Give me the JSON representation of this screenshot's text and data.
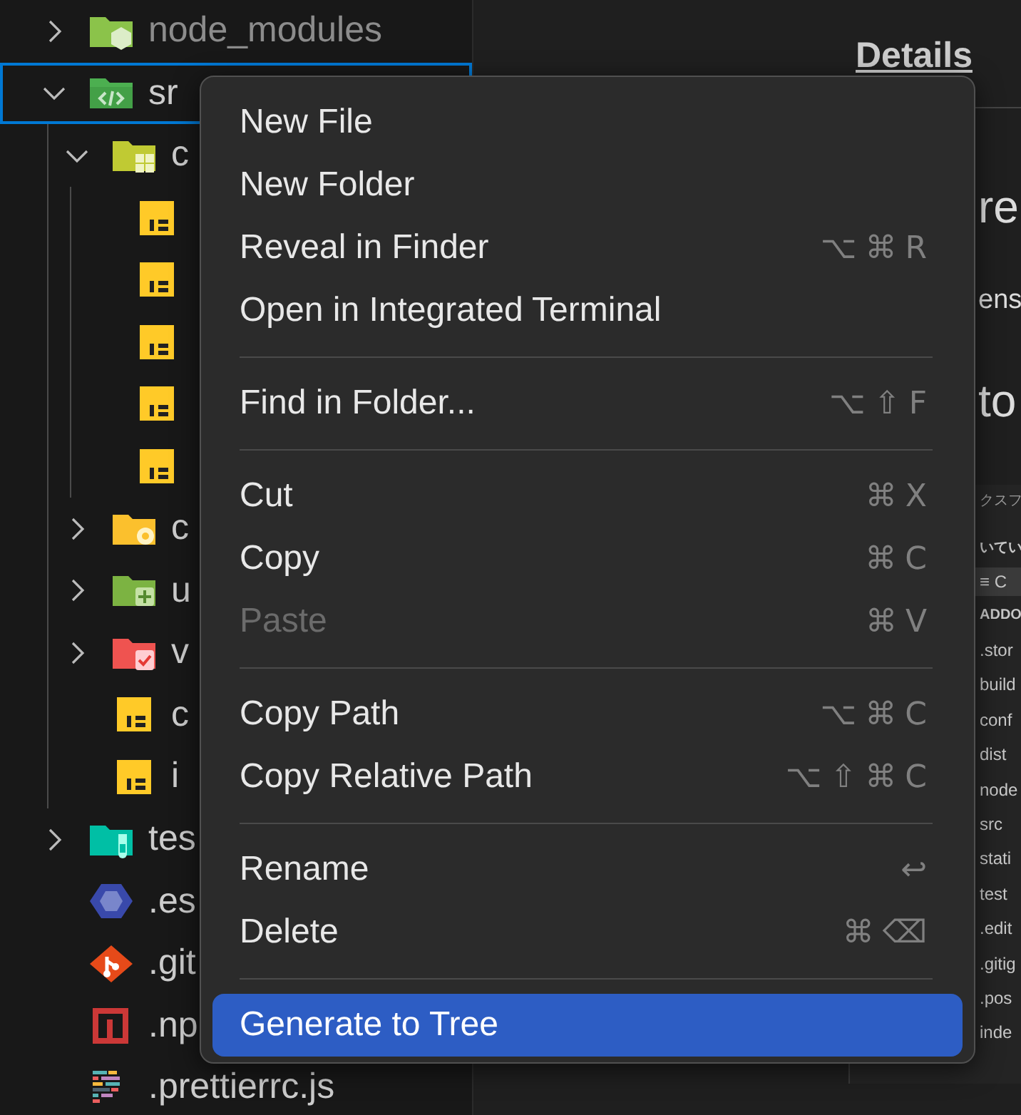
{
  "explorer": {
    "items": [
      {
        "label": "node_modules",
        "kind": "node-folder",
        "expanded": false,
        "ignored": true,
        "selected": false
      },
      {
        "label": "sr",
        "kind": "src-folder",
        "expanded": true,
        "ignored": false,
        "selected": true,
        "children": [
          {
            "label": "c",
            "kind": "components-folder",
            "expanded": true,
            "ignored": false,
            "selected": false,
            "children": [
              {
                "kind": "js-file"
              },
              {
                "kind": "js-file"
              },
              {
                "kind": "js-file"
              },
              {
                "kind": "js-file"
              },
              {
                "kind": "js-file"
              }
            ]
          },
          {
            "label": "c",
            "kind": "config-folder",
            "expanded": false,
            "ignored": false,
            "selected": false
          },
          {
            "label": "u",
            "kind": "utils-folder",
            "expanded": false,
            "ignored": false,
            "selected": false
          },
          {
            "label": "v",
            "kind": "validation-folder",
            "expanded": false,
            "ignored": false,
            "selected": false
          },
          {
            "label": "c",
            "kind": "js-file",
            "ignored": false,
            "selected": false
          },
          {
            "label": "i",
            "kind": "js-file",
            "ignored": false,
            "selected": false
          }
        ]
      },
      {
        "label": "tes",
        "kind": "test-folder",
        "expanded": false,
        "ignored": false,
        "selected": false
      },
      {
        "label": ".es",
        "kind": "eslint-file",
        "ignored": false,
        "selected": false
      },
      {
        "label": ".git",
        "kind": "git-file",
        "ignored": false,
        "selected": false
      },
      {
        "label": ".np",
        "kind": "npm-file",
        "ignored": false,
        "selected": false
      },
      {
        "label": ".prettierrc.js",
        "kind": "prettier-file",
        "ignored": false,
        "selected": false
      }
    ]
  },
  "details_panel": {
    "tab": {
      "label": "Details",
      "selected": true
    },
    "fragments": [
      {
        "text": "re",
        "kind": "heading"
      },
      {
        "text": "ens",
        "kind": "text"
      },
      {
        "text": "to",
        "kind": "heading"
      }
    ],
    "embedded_screenshot": {
      "lines": [
        {
          "text": "クスフ",
          "kind": "title"
        },
        {
          "text": "いてい",
          "kind": "heading"
        },
        {
          "text": "≡ C",
          "kind": "toolbar"
        },
        {
          "text": "ADDO",
          "kind": "section"
        },
        {
          "text": ".stor",
          "kind": "entry"
        },
        {
          "text": "build",
          "kind": "entry"
        },
        {
          "text": "conf",
          "kind": "entry"
        },
        {
          "text": "dist",
          "kind": "entry"
        },
        {
          "text": "node",
          "kind": "entry"
        },
        {
          "text": "src",
          "kind": "entry"
        },
        {
          "text": "stati",
          "kind": "entry"
        },
        {
          "text": "test",
          "kind": "entry"
        },
        {
          "text": ".edit",
          "kind": "entry"
        },
        {
          "text": ".gitig",
          "kind": "entry"
        },
        {
          "text": ".pos",
          "kind": "entry"
        },
        {
          "text": "inde",
          "kind": "entry"
        }
      ]
    }
  },
  "context_menu": {
    "groups": [
      {
        "items": [
          {
            "label": "New File",
            "disabled": false,
            "selected": false
          },
          {
            "label": "New Folder",
            "disabled": false,
            "selected": false
          },
          {
            "label": "Reveal in Finder",
            "shortcut": "⌥⌘R",
            "disabled": false,
            "selected": false
          },
          {
            "label": "Open in Integrated Terminal",
            "disabled": false,
            "selected": false
          }
        ]
      },
      {
        "items": [
          {
            "label": "Find in Folder...",
            "shortcut": "⌥⇧F",
            "disabled": false,
            "selected": false
          }
        ]
      },
      {
        "items": [
          {
            "label": "Cut",
            "shortcut": "⌘X",
            "disabled": false,
            "selected": false
          },
          {
            "label": "Copy",
            "shortcut": "⌘C",
            "disabled": false,
            "selected": false
          },
          {
            "label": "Paste",
            "shortcut": "⌘V",
            "disabled": true,
            "selected": false
          }
        ]
      },
      {
        "items": [
          {
            "label": "Copy Path",
            "shortcut": "⌥⌘C",
            "disabled": false,
            "selected": false
          },
          {
            "label": "Copy Relative Path",
            "shortcut": "⌥⇧⌘C",
            "disabled": false,
            "selected": false
          }
        ]
      },
      {
        "items": [
          {
            "label": "Rename",
            "shortcut": "↩",
            "disabled": false,
            "selected": false
          },
          {
            "label": "Delete",
            "shortcut": "⌘⌫",
            "disabled": false,
            "selected": false
          }
        ]
      },
      {
        "items": [
          {
            "label": "Generate to Tree",
            "disabled": false,
            "selected": true
          }
        ]
      }
    ]
  }
}
